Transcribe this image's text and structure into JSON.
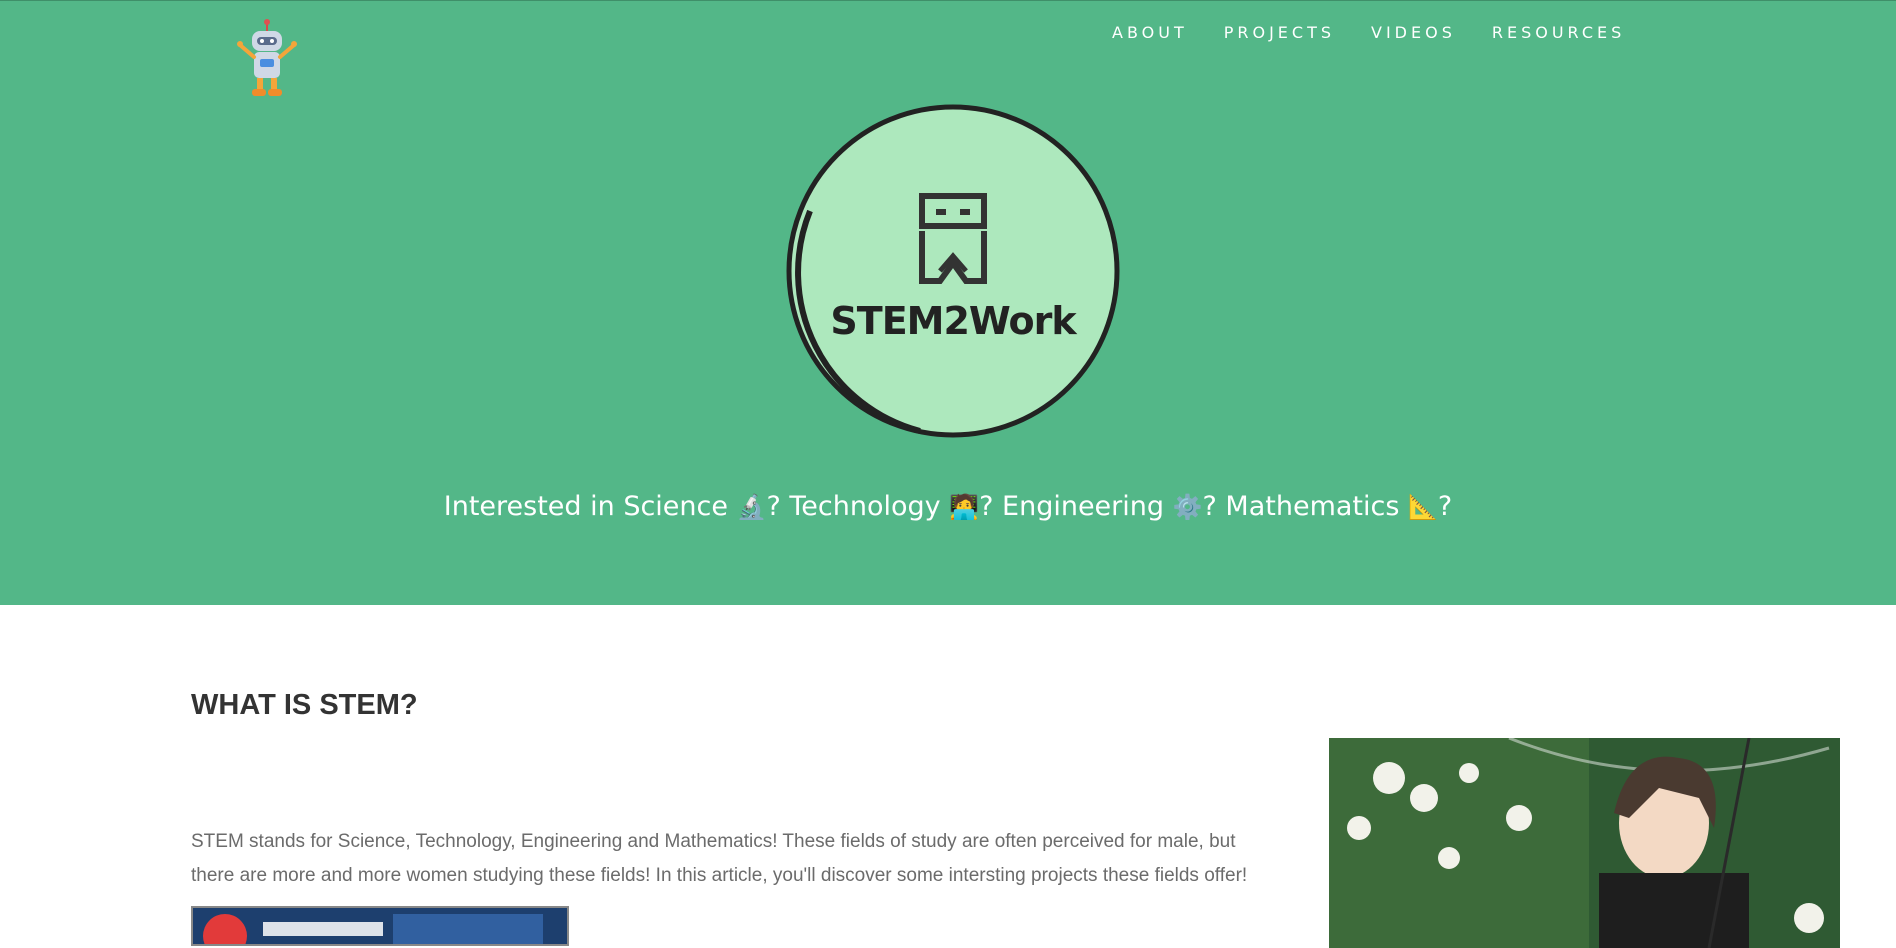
{
  "nav": {
    "items": [
      "ABOUT",
      "PROJECTS",
      "VIDEOS",
      "RESOURCES"
    ]
  },
  "logo": {
    "text": "STEM2Work"
  },
  "hero": {
    "tagline": {
      "part1": "Interested in Science ",
      "emoji1": "🔬",
      "part2": "? Technology ",
      "emoji2": "🧑‍💻",
      "part3": "? Engineering ",
      "emoji3": "⚙️",
      "part4": "? Mathematics ",
      "emoji4": "📐",
      "part5": "?"
    }
  },
  "section": {
    "heading": "WHAT IS STEM?",
    "paragraph": "STEM stands for Science, Technology, Engineering and Mathematics! These fields of study are often perceived for male, but there are more and more women studying these fields! In this article, you'll discover some intersting projects these fields offer!"
  },
  "colors": {
    "hero_bg": "#53b788",
    "logo_circle": "#ade8bd",
    "heading": "#333333",
    "body_text": "#6b6b6b"
  }
}
